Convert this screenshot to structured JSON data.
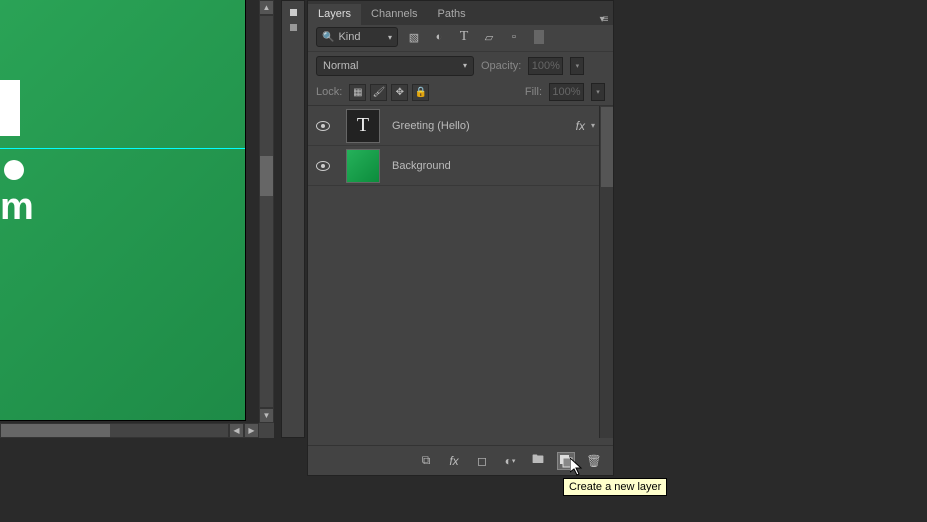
{
  "tabs": {
    "layers": "Layers",
    "channels": "Channels",
    "paths": "Paths"
  },
  "filter": {
    "kind": "Kind"
  },
  "blend": {
    "mode": "Normal",
    "opacity_label": "Opacity:",
    "opacity_value": "100%"
  },
  "lock": {
    "label": "Lock:",
    "fill_label": "Fill:",
    "fill_value": "100%"
  },
  "layers_list": [
    {
      "name": "Greeting (Hello)",
      "type": "T",
      "has_fx": true
    },
    {
      "name": "Background",
      "type": "img"
    }
  ],
  "bottom_icons": {
    "link": "⧉",
    "fx": "fx",
    "mask": "▢",
    "adjust": "◐",
    "group": "🖿",
    "new": "⬒",
    "trash": "🗑"
  },
  "tooltip": "Create a new layer",
  "canvas_text": "m"
}
